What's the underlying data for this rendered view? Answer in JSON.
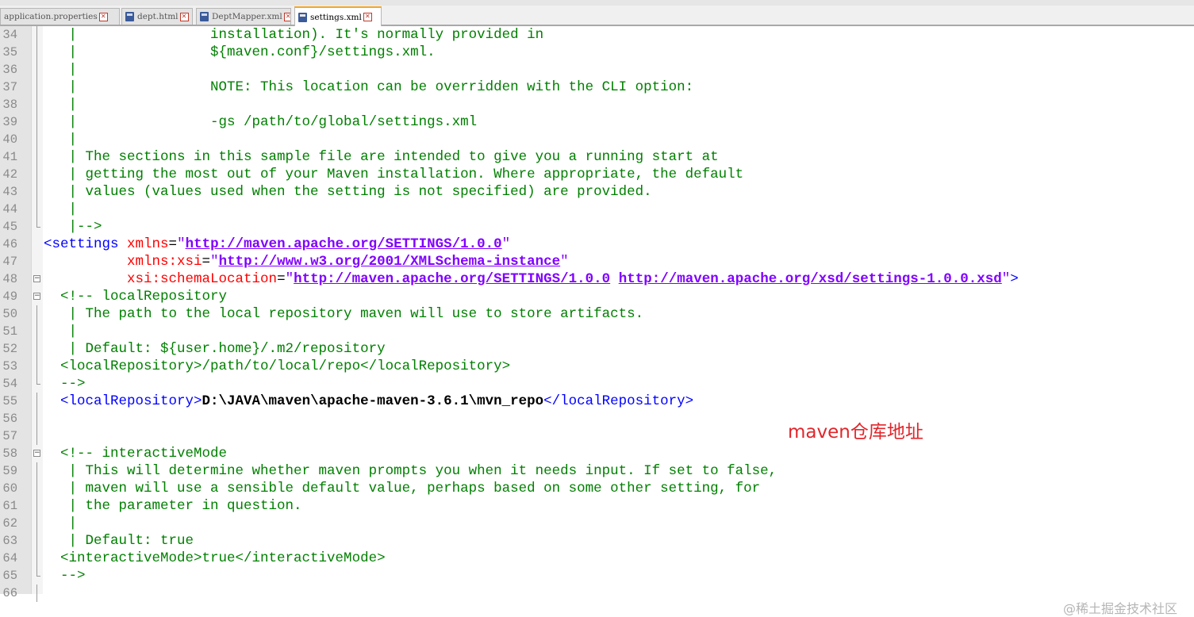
{
  "tabs": [
    {
      "label": "application.properties",
      "active": false
    },
    {
      "label": "dept.html",
      "active": false
    },
    {
      "label": "DeptMapper.xml",
      "active": false
    },
    {
      "label": "settings.xml",
      "active": true
    }
  ],
  "lines": [
    {
      "n": "34",
      "fold": "vline",
      "segs": [
        {
          "c": "cm",
          "t": "   |                installation). It's normally provided in"
        }
      ]
    },
    {
      "n": "35",
      "fold": "vline",
      "segs": [
        {
          "c": "cm",
          "t": "   |                ${maven.conf}/settings.xml."
        }
      ]
    },
    {
      "n": "36",
      "fold": "vline",
      "segs": [
        {
          "c": "cm",
          "t": "   |"
        }
      ]
    },
    {
      "n": "37",
      "fold": "vline",
      "segs": [
        {
          "c": "cm",
          "t": "   |                NOTE: This location can be overridden with the CLI option:"
        }
      ]
    },
    {
      "n": "38",
      "fold": "vline",
      "segs": [
        {
          "c": "cm",
          "t": "   |"
        }
      ]
    },
    {
      "n": "39",
      "fold": "vline",
      "segs": [
        {
          "c": "cm",
          "t": "   |                -gs /path/to/global/settings.xml"
        }
      ]
    },
    {
      "n": "40",
      "fold": "vline",
      "segs": [
        {
          "c": "cm",
          "t": "   |"
        }
      ]
    },
    {
      "n": "41",
      "fold": "vline",
      "segs": [
        {
          "c": "cm",
          "t": "   | The sections in this sample file are intended to give you a running start at"
        }
      ]
    },
    {
      "n": "42",
      "fold": "vline",
      "segs": [
        {
          "c": "cm",
          "t": "   | getting the most out of your Maven installation. Where appropriate, the default"
        }
      ]
    },
    {
      "n": "43",
      "fold": "vline",
      "segs": [
        {
          "c": "cm",
          "t": "   | values (values used when the setting is not specified) are provided."
        }
      ]
    },
    {
      "n": "44",
      "fold": "vline",
      "segs": [
        {
          "c": "cm",
          "t": "   |"
        }
      ]
    },
    {
      "n": "45",
      "fold": "endline",
      "segs": [
        {
          "c": "cm",
          "t": "   |-->"
        }
      ]
    },
    {
      "n": "46",
      "fold": "",
      "segs": [
        {
          "c": "tg",
          "t": "<settings "
        },
        {
          "c": "at",
          "t": "xmlns"
        },
        {
          "c": "tx0",
          "t": "="
        },
        {
          "c": "q",
          "t": "\""
        },
        {
          "c": "st",
          "t": "http://maven.apache.org/SETTINGS/1.0.0"
        },
        {
          "c": "q",
          "t": "\""
        }
      ]
    },
    {
      "n": "47",
      "fold": "",
      "segs": [
        {
          "c": "tg",
          "t": "          "
        },
        {
          "c": "at",
          "t": "xmlns:xsi"
        },
        {
          "c": "tx0",
          "t": "="
        },
        {
          "c": "q",
          "t": "\""
        },
        {
          "c": "st",
          "t": "http://www.w3.org/2001/XMLSchema-instance"
        },
        {
          "c": "q",
          "t": "\""
        }
      ]
    },
    {
      "n": "48",
      "fold": "box",
      "segs": [
        {
          "c": "tg",
          "t": "          "
        },
        {
          "c": "at",
          "t": "xsi:schemaLocation"
        },
        {
          "c": "tx0",
          "t": "="
        },
        {
          "c": "q",
          "t": "\""
        },
        {
          "c": "st",
          "t": "http://maven.apache.org/SETTINGS/1.0.0"
        },
        {
          "c": "q",
          "t": " "
        },
        {
          "c": "st",
          "t": "http://maven.apache.org/xsd/settings-1.0.0.xsd"
        },
        {
          "c": "q",
          "t": "\""
        },
        {
          "c": "tg",
          "t": ">"
        }
      ]
    },
    {
      "n": "49",
      "fold": "box",
      "segs": [
        {
          "c": "cm",
          "t": "  <!-- localRepository"
        }
      ]
    },
    {
      "n": "50",
      "fold": "vline",
      "segs": [
        {
          "c": "cm",
          "t": "   | The path to the local repository maven will use to store artifacts."
        }
      ]
    },
    {
      "n": "51",
      "fold": "vline",
      "segs": [
        {
          "c": "cm",
          "t": "   |"
        }
      ]
    },
    {
      "n": "52",
      "fold": "vline",
      "segs": [
        {
          "c": "cm",
          "t": "   | Default: ${user.home}/.m2/repository"
        }
      ]
    },
    {
      "n": "53",
      "fold": "vline",
      "segs": [
        {
          "c": "cm",
          "t": "  <localRepository>/path/to/local/repo</localRepository>"
        }
      ]
    },
    {
      "n": "54",
      "fold": "endline",
      "segs": [
        {
          "c": "cm",
          "t": "  -->"
        }
      ]
    },
    {
      "n": "55",
      "fold": "vline",
      "segs": [
        {
          "c": "tg",
          "t": "  <localRepository>"
        },
        {
          "c": "tx",
          "t": "D:\\JAVA\\maven\\apache-maven-3.6.1\\mvn_repo"
        },
        {
          "c": "tg",
          "t": "</localRepository>"
        }
      ]
    },
    {
      "n": "56",
      "fold": "vline",
      "segs": []
    },
    {
      "n": "57",
      "fold": "vline",
      "segs": []
    },
    {
      "n": "58",
      "fold": "box",
      "segs": [
        {
          "c": "cm",
          "t": "  <!-- interactiveMode"
        }
      ]
    },
    {
      "n": "59",
      "fold": "vline",
      "segs": [
        {
          "c": "cm",
          "t": "   | This will determine whether maven prompts you when it needs input. If set to false,"
        }
      ]
    },
    {
      "n": "60",
      "fold": "vline",
      "segs": [
        {
          "c": "cm",
          "t": "   | maven will use a sensible default value, perhaps based on some other setting, for"
        }
      ]
    },
    {
      "n": "61",
      "fold": "vline",
      "segs": [
        {
          "c": "cm",
          "t": "   | the parameter in question."
        }
      ]
    },
    {
      "n": "62",
      "fold": "vline",
      "segs": [
        {
          "c": "cm",
          "t": "   |"
        }
      ]
    },
    {
      "n": "63",
      "fold": "vline",
      "segs": [
        {
          "c": "cm",
          "t": "   | Default: true"
        }
      ]
    },
    {
      "n": "64",
      "fold": "vline",
      "segs": [
        {
          "c": "cm",
          "t": "  <interactiveMode>true</interactiveMode>"
        }
      ]
    },
    {
      "n": "65",
      "fold": "endline",
      "segs": [
        {
          "c": "cm",
          "t": "  -->"
        }
      ]
    },
    {
      "n": "66",
      "fold": "vline",
      "segs": []
    }
  ],
  "annotation": "maven仓库地址",
  "watermark": "@稀土掘金技术社区",
  "colors": {
    "comment": "#008000",
    "tag": "#0000ff",
    "attribute": "#ff0000",
    "string": "#8000ff",
    "annotation": "#e1262b"
  }
}
